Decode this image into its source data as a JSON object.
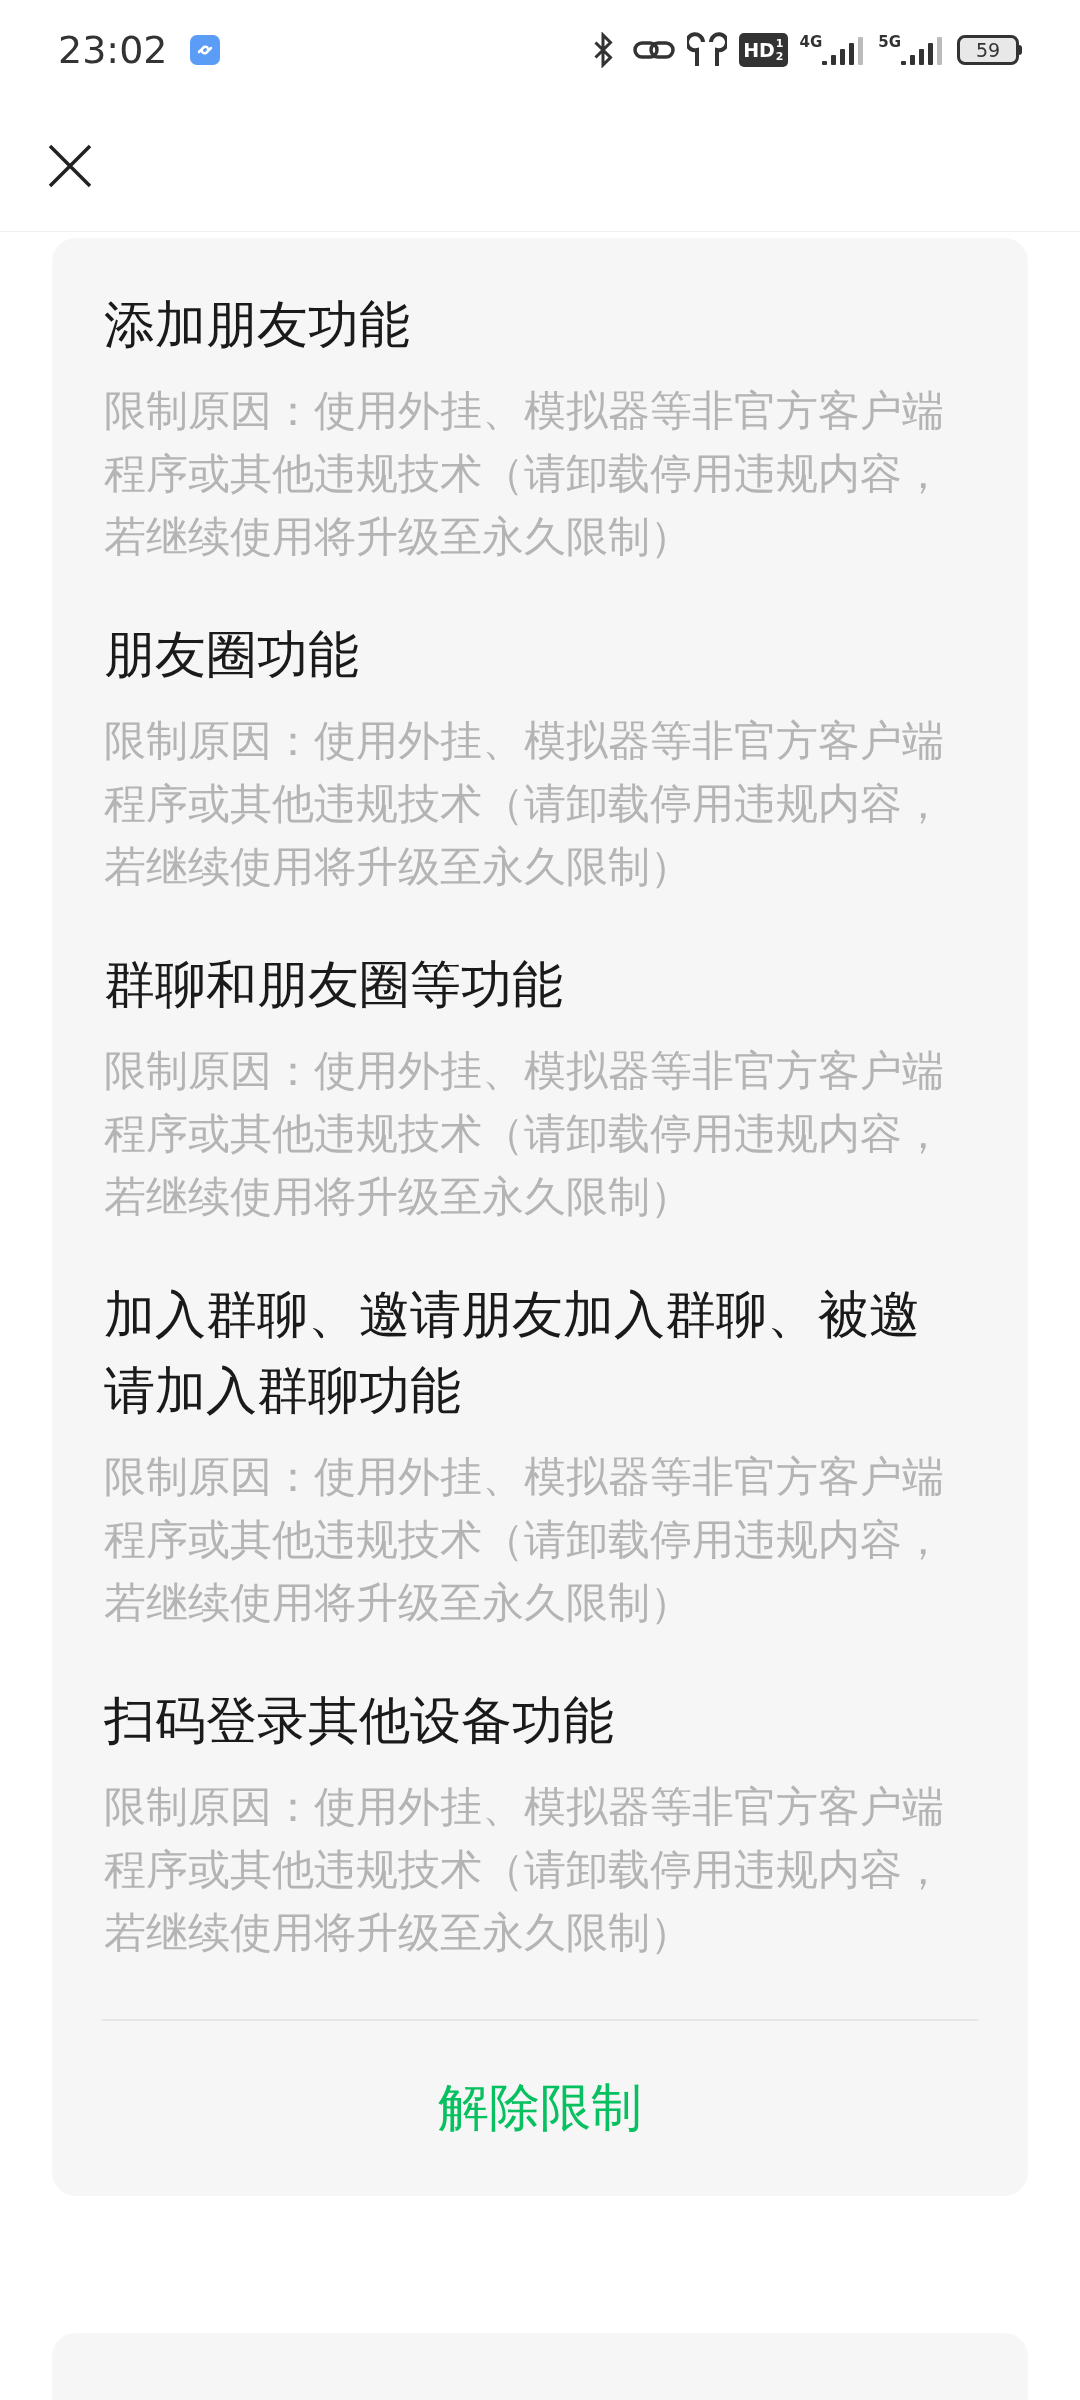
{
  "status_bar": {
    "time": "23:02",
    "hd_badge": "HD",
    "hd_slots": [
      "1",
      "2"
    ],
    "network_labels": [
      "4G",
      "5G"
    ],
    "battery": "59"
  },
  "restrictions": [
    {
      "title": "添加朋友功能",
      "reason": "限制原因：使用外挂、模拟器等非官方客户端程序或其他违规技术（请卸载停用违规内容，若继续使用将升级至永久限制）"
    },
    {
      "title": "朋友圈功能",
      "reason": "限制原因：使用外挂、模拟器等非官方客户端程序或其他违规技术（请卸载停用违规内容，若继续使用将升级至永久限制）"
    },
    {
      "title": "群聊和朋友圈等功能",
      "reason": "限制原因：使用外挂、模拟器等非官方客户端程序或其他违规技术（请卸载停用违规内容，若继续使用将升级至永久限制）"
    },
    {
      "title": "加入群聊、邀请朋友加入群聊、被邀请加入群聊功能",
      "reason": "限制原因：使用外挂、模拟器等非官方客户端程序或其他违规技术（请卸载停用违规内容，若继续使用将升级至永久限制）"
    },
    {
      "title": "扫码登录其他设备功能",
      "reason": "限制原因：使用外挂、模拟器等非官方客户端程序或其他违规技术（请卸载停用违规内容，若继续使用将升级至永久限制）"
    }
  ],
  "action_button": "解除限制"
}
